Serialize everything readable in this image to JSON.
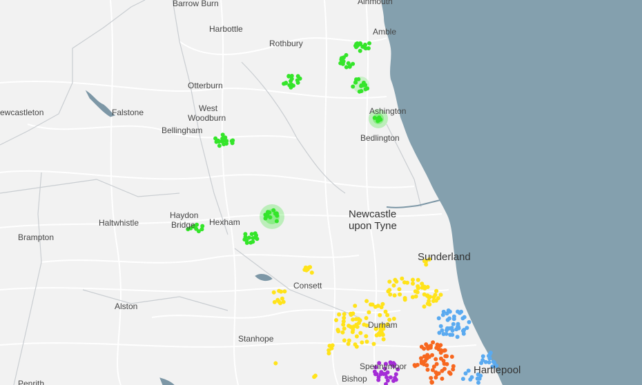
{
  "map": {
    "colors": {
      "land": "#f2f2f2",
      "sea": "#84a0ae",
      "roads": "#ffffff",
      "boundary": "#c9cdd1",
      "river": "#7d97a6"
    },
    "clusters": [
      {
        "name": "green",
        "color": "#34e52a"
      },
      {
        "name": "yellow",
        "color": "#ffe31a"
      },
      {
        "name": "blue",
        "color": "#5aaaf0"
      },
      {
        "name": "orange",
        "color": "#f7671f"
      },
      {
        "name": "purple",
        "color": "#a42cd6"
      }
    ],
    "places": [
      {
        "id": "barrow-burn",
        "text": "Barrow Burn"
      },
      {
        "id": "alnmouth",
        "text": "Alnmouth"
      },
      {
        "id": "harbottle",
        "text": "Harbottle"
      },
      {
        "id": "amble",
        "text": "Amble"
      },
      {
        "id": "rothbury",
        "text": "Rothbury"
      },
      {
        "id": "otterburn",
        "text": "Otterburn"
      },
      {
        "id": "newcastleton",
        "text": "ewcastleton"
      },
      {
        "id": "falstone",
        "text": "Falstone"
      },
      {
        "id": "west-woodburn-1",
        "text": "West"
      },
      {
        "id": "west-woodburn-2",
        "text": "Woodburn"
      },
      {
        "id": "ashington",
        "text": "Ashington"
      },
      {
        "id": "bellingham",
        "text": "Bellingham"
      },
      {
        "id": "bedlington",
        "text": "Bedlington"
      },
      {
        "id": "newcastle-1",
        "text": "Newcastle"
      },
      {
        "id": "newcastle-2",
        "text": "upon Tyne"
      },
      {
        "id": "haydon-1",
        "text": "Haydon"
      },
      {
        "id": "haydon-2",
        "text": "Bridge"
      },
      {
        "id": "haltwhistle",
        "text": "Haltwhistle"
      },
      {
        "id": "hexham",
        "text": "Hexham"
      },
      {
        "id": "brampton",
        "text": "Brampton"
      },
      {
        "id": "sunderland",
        "text": "Sunderland"
      },
      {
        "id": "consett",
        "text": "Consett"
      },
      {
        "id": "alston",
        "text": "Alston"
      },
      {
        "id": "durham",
        "text": "Durham"
      },
      {
        "id": "stanhope",
        "text": "Stanhope"
      },
      {
        "id": "spennymoor",
        "text": "Spennymoor"
      },
      {
        "id": "hartlepool",
        "text": "Hartlepool"
      },
      {
        "id": "bishop",
        "text": "Bishop"
      },
      {
        "id": "penrith",
        "text": "Penrith"
      }
    ]
  }
}
